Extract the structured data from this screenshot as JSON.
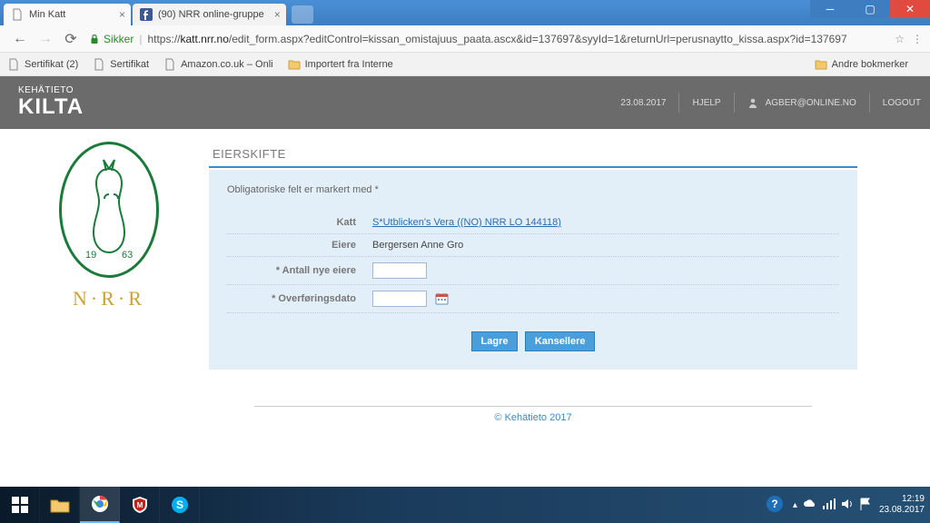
{
  "chrome": {
    "tabs": [
      {
        "title": "Min Katt"
      },
      {
        "title": "(90) NRR online-gruppe"
      }
    ],
    "secure_label": "Sikker",
    "url_prefix": "https://",
    "url_domain": "katt.nrr.no",
    "url_rest": "/edit_form.aspx?editControl=kissan_omistajuus_paata.ascx&id=137697&syyId=1&returnUrl=perusnaytto_kissa.aspx?id=137697",
    "bookmarks": [
      {
        "label": "Sertifikat (2)"
      },
      {
        "label": "Sertifikat"
      },
      {
        "label": "Amazon.co.uk – Onli"
      },
      {
        "label": "Importert fra Interne"
      }
    ],
    "other_bookmarks": "Andre bokmerker"
  },
  "header": {
    "brand_small": "KEHÄTIETO",
    "brand_big": "KILTA",
    "date": "23.08.2017",
    "help": "HJELP",
    "user": "AGBER@ONLINE.NO",
    "logout": "LOGOUT"
  },
  "sidebar": {
    "org_initials": "N·R·R",
    "logo_year_left": "19",
    "logo_year_right": "63"
  },
  "form": {
    "section_title": "EIERSKIFTE",
    "mandatory_note": "Obligatoriske felt er markert med *",
    "labels": {
      "katt": "Katt",
      "eiere": "Eiere",
      "antall": "* Antall nye eiere",
      "dato": "* Overføringsdato"
    },
    "values": {
      "katt_link": "S*Utblicken's Vera ((NO) NRR LO 144118)",
      "eiere": "Bergersen Anne Gro",
      "antall": "",
      "dato": ""
    },
    "buttons": {
      "save": "Lagre",
      "cancel": "Kansellere"
    }
  },
  "footer": "© Kehätieto 2017",
  "taskbar": {
    "time": "12:19",
    "date": "23.08.2017"
  }
}
